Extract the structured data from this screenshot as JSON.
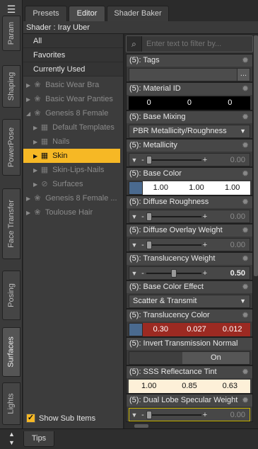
{
  "left_tabs": [
    "Param",
    "Shaping",
    "PowerPose",
    "Face Transfer",
    "Posing",
    "Surfaces",
    "Lights"
  ],
  "left_tabs_active": "Surfaces",
  "top_tabs": [
    "Presets",
    "Editor",
    "Shader Baker"
  ],
  "top_tabs_active": "Editor",
  "shader_label": "Shader : Iray Uber",
  "tree_top_items": [
    "All",
    "Favorites",
    "Currently Used"
  ],
  "tree_nodes": [
    {
      "label": "Basic Wear Bra",
      "icon": "figure-icon"
    },
    {
      "label": "Basic Wear Panties",
      "icon": "figure-icon"
    },
    {
      "label": "Genesis 8 Female",
      "icon": "figure-icon"
    },
    {
      "label": "Default Templates",
      "icon": "material-group-icon"
    },
    {
      "label": "Nails",
      "icon": "material-group-icon"
    },
    {
      "label": "Skin",
      "icon": "material-group-icon"
    },
    {
      "label": "Skin-Lips-Nails",
      "icon": "material-group-icon"
    },
    {
      "label": "Surfaces",
      "icon": "surfaces-icon"
    },
    {
      "label": "Genesis 8 Female ...",
      "icon": "figure-icon"
    },
    {
      "label": "Toulouse Hair",
      "icon": "figure-icon"
    }
  ],
  "selected_node": "Skin",
  "show_sub_items_label": "Show Sub Items",
  "show_sub_items_checked": true,
  "filter_placeholder": "Enter text to filter by...",
  "properties": {
    "tags": {
      "label": "(5): Tags",
      "button": "..."
    },
    "material_id": {
      "label": "(5): Material ID",
      "values": [
        "0",
        "0",
        "0"
      ]
    },
    "base_mixing": {
      "label": "(5): Base Mixing",
      "value": "PBR Metallicity/Roughness"
    },
    "metallicity": {
      "label": "(5): Metallicity",
      "value": "0.00",
      "level": 0.0
    },
    "base_color": {
      "label": "(5): Base Color",
      "values": [
        "1.00",
        "1.00",
        "1.00"
      ],
      "swatch": "#4a6a8f"
    },
    "diffuse_roughness": {
      "label": "(5): Diffuse Roughness",
      "value": "0.00",
      "level": 0.0
    },
    "diffuse_overlay_weight": {
      "label": "(5): Diffuse Overlay Weight",
      "value": "0.00",
      "level": 0.0
    },
    "translucency_weight": {
      "label": "(5): Translucency Weight",
      "value": "0.50",
      "level": 0.5
    },
    "base_color_effect": {
      "label": "(5): Base Color Effect",
      "value": "Scatter & Transmit"
    },
    "translucency_color": {
      "label": "(5): Translucency Color",
      "values": [
        "0.30",
        "0.027",
        "0.012"
      ],
      "swatch": "#4a6a8f",
      "cell_color": "#9c2a22"
    },
    "invert_transmission_normal": {
      "label": "(5): Invert Transmission Normal",
      "value": "On"
    },
    "sss_reflectance_tint": {
      "label": "(5): SSS Reflectance Tint",
      "values": [
        "1.00",
        "0.85",
        "0.63"
      ],
      "cell_color": "#fdf0d8"
    },
    "dual_lobe_specular_weight": {
      "label": "(5): Dual Lobe Specular Weight",
      "value": "0.00",
      "level": 0.0
    }
  },
  "bottom_tab": "Tips",
  "colors": {
    "accent": "#f6b825",
    "panel": "#3a3a3a",
    "header": "#474747"
  }
}
